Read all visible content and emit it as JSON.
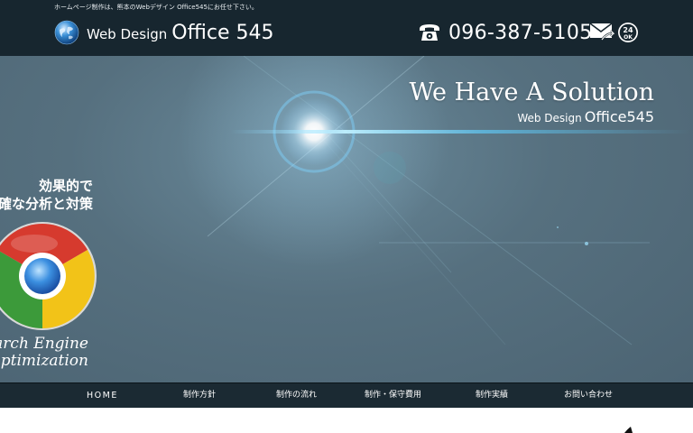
{
  "header": {
    "tagline": "ホームページ制作は、熊本のWebデザイン Office545にお任せ下さい。",
    "logo": {
      "small": "Web Design",
      "big": "Office 545",
      "icon": "globe-icon"
    },
    "phone": {
      "icon": "phone-icon",
      "number": "096-387-5105"
    },
    "icons": {
      "mail": "mail-icon",
      "h24": "24h-ok-icon",
      "h24_top": "24",
      "h24_bottom": "OK"
    }
  },
  "hero": {
    "title": "We Have A Solution",
    "sub_small": "Web Design",
    "sub_big": "Office545",
    "seo_line1": "効果的で",
    "seo_line2": "確な分析と対策",
    "seo_caption1": "arch Engine",
    "seo_caption2": "ptimization",
    "seo_icon": "chrome-icon"
  },
  "nav": {
    "items": [
      {
        "label": "HOME"
      },
      {
        "label": "制作方針"
      },
      {
        "label": "制作の流れ"
      },
      {
        "label": "制作・保守費用"
      },
      {
        "label": "制作実績"
      },
      {
        "label": "お問い合わせ"
      }
    ]
  },
  "colors": {
    "header_bg": "#17262f",
    "hero_bg": "#56707f",
    "nav_bg": "#1b2a33",
    "text": "#ffffff"
  }
}
